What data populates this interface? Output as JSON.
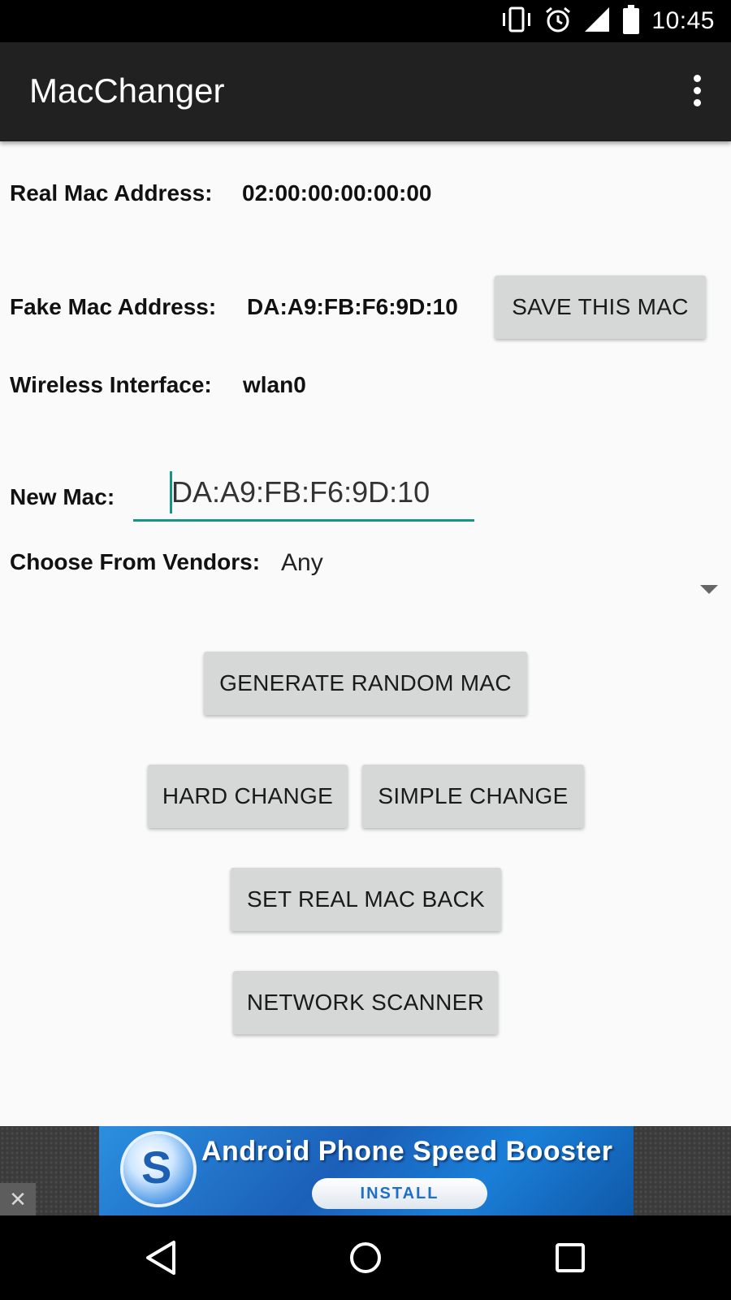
{
  "status_bar": {
    "time": "10:45",
    "icons": [
      "vibrate-icon",
      "alarm-icon",
      "signal-icon",
      "battery-icon"
    ]
  },
  "app_bar": {
    "title": "MacChanger",
    "overflow_icon": "more-vert-icon"
  },
  "info": {
    "real_mac_label": "Real Mac Address:",
    "real_mac_value": "02:00:00:00:00:00",
    "fake_mac_label": "Fake Mac Address:",
    "fake_mac_value": "DA:A9:FB:F6:9D:10",
    "interface_label": "Wireless Interface:",
    "interface_value": "wlan0"
  },
  "form": {
    "new_mac_label": "New Mac:",
    "new_mac_value": "DA:A9:FB:F6:9D:10",
    "vendor_label": "Choose From Vendors:",
    "vendor_selected": "Any"
  },
  "buttons": {
    "save_mac": "SAVE THIS MAC",
    "generate_random": "GENERATE RANDOM MAC",
    "hard_change": "HARD CHANGE",
    "simple_change": "SIMPLE CHANGE",
    "set_real_back": "SET REAL MAC BACK",
    "network_scanner": "NETWORK SCANNER"
  },
  "ad": {
    "title": "Android Phone Speed Booster",
    "install_label": "INSTALL",
    "close_glyph": "✕"
  },
  "colors": {
    "app_bar": "#212121",
    "accent": "#159488",
    "button_bg": "#d6d7d7",
    "background": "#fafafa"
  }
}
